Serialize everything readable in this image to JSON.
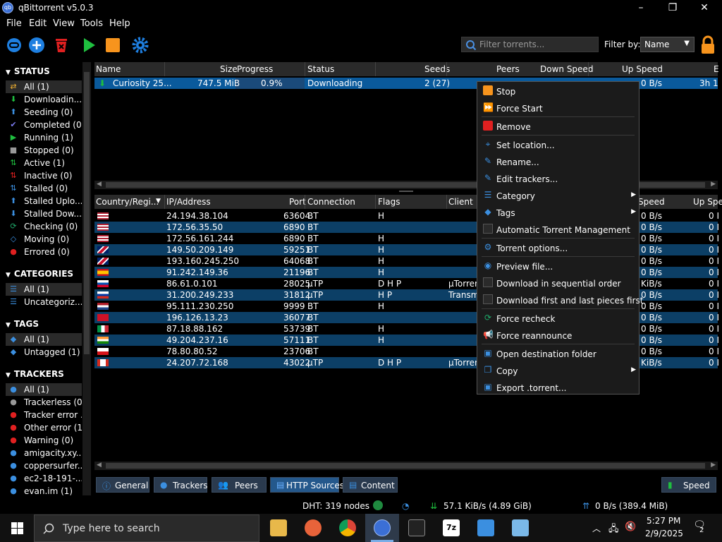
{
  "window": {
    "title": "qBittorrent v5.0.3",
    "app_icon": "qb",
    "minimize": "–",
    "maximize": "❐",
    "close": "✕"
  },
  "menubar": {
    "file": "File",
    "edit": "Edit",
    "view": "View",
    "tools": "Tools",
    "help": "Help"
  },
  "toolbar": {
    "filter_placeholder": "Filter torrents...",
    "filter_by_label": "Filter by:",
    "filter_by_value": "Name"
  },
  "sidebar": {
    "status_header": "STATUS",
    "status": [
      "All (1)",
      "Downloadin...",
      "Seeding (0)",
      "Completed (0)",
      "Running (1)",
      "Stopped (0)",
      "Active (1)",
      "Inactive (0)",
      "Stalled (0)",
      "Stalled Uplo...",
      "Stalled Dow...",
      "Checking (0)",
      "Moving (0)",
      "Errored (0)"
    ],
    "categories_header": "CATEGORIES",
    "categories": [
      "All (1)",
      "Uncategoriz..."
    ],
    "tags_header": "TAGS",
    "tags": [
      "All (1)",
      "Untagged (1)"
    ],
    "trackers_header": "TRACKERS",
    "trackers": [
      "All (1)",
      "Trackerless (0)",
      "Tracker error ...",
      "Other error (1)",
      "Warning (0)",
      "amigacity.xy...",
      "coppersurfer...",
      "ec2-18-191-...",
      "evan.im (1)"
    ]
  },
  "torrents": {
    "headers": [
      "Name",
      "Size",
      "Progress",
      "Status",
      "Seeds",
      "Peers",
      "Down Speed",
      "Up Speed",
      "E"
    ],
    "rows": [
      {
        "name": "Curiosity 25...",
        "size": "747.5 MiB",
        "progress": "0.9%",
        "status": "Downloading",
        "seeds": "2 (27)",
        "up": "0 B/s",
        "eta": "3h 1"
      }
    ]
  },
  "peers": {
    "headers": [
      "Country/Regi...",
      "IP/Address",
      "Port",
      "Connection",
      "Flags",
      "Client",
      "Speed",
      "Up Spe"
    ],
    "rows": [
      {
        "ip": "24.194.38.104",
        "port": "63604",
        "conn": "BT",
        "flags": "H",
        "client": "",
        "dl": "0 B/s",
        "ul": "0 I"
      },
      {
        "ip": "172.56.35.50",
        "port": "6890",
        "conn": "BT",
        "flags": "",
        "client": "",
        "dl": "0 B/s",
        "ul": "0 I"
      },
      {
        "ip": "172.56.161.244",
        "port": "6890",
        "conn": "BT",
        "flags": "H",
        "client": "",
        "dl": "0 B/s",
        "ul": "0 I"
      },
      {
        "ip": "149.50.209.149",
        "port": "59251",
        "conn": "BT",
        "flags": "H",
        "client": "",
        "dl": "0 B/s",
        "ul": "0 I"
      },
      {
        "ip": "193.160.245.250",
        "port": "64068",
        "conn": "BT",
        "flags": "H",
        "client": "",
        "dl": "0 B/s",
        "ul": "0 I"
      },
      {
        "ip": "91.242.149.36",
        "port": "21196",
        "conn": "BT",
        "flags": "H",
        "client": "",
        "dl": "0 B/s",
        "ul": "0 I"
      },
      {
        "ip": "86.61.0.101",
        "port": "28025",
        "conn": "µTP",
        "flags": "D H P",
        "client": "µTorrent",
        "dl": "KiB/s",
        "ul": "0 I"
      },
      {
        "ip": "31.200.249.233",
        "port": "31812",
        "conn": "µTP",
        "flags": "H P",
        "client": "Transm",
        "dl": "0 B/s",
        "ul": "0 I"
      },
      {
        "ip": "95.111.230.250",
        "port": "9999",
        "conn": "BT",
        "flags": "H",
        "client": "",
        "dl": "0 B/s",
        "ul": "0 I"
      },
      {
        "ip": "196.126.13.23",
        "port": "36077",
        "conn": "BT",
        "flags": "",
        "client": "",
        "dl": "0 B/s",
        "ul": "0 I"
      },
      {
        "ip": "87.18.88.162",
        "port": "53739",
        "conn": "BT",
        "flags": "H",
        "client": "",
        "dl": "0 B/s",
        "ul": "0 I"
      },
      {
        "ip": "49.204.237.16",
        "port": "57111",
        "conn": "BT",
        "flags": "H",
        "client": "",
        "dl": "0 B/s",
        "ul": "0 I"
      },
      {
        "ip": "78.80.80.52",
        "port": "23706",
        "conn": "BT",
        "flags": "",
        "client": "",
        "dl": "0 B/s",
        "ul": "0 I"
      },
      {
        "ip": "24.207.72.168",
        "port": "43022",
        "conn": "µTP",
        "flags": "D H P",
        "client": "µTorren",
        "dl": "KiB/s",
        "ul": "0 I"
      }
    ]
  },
  "tabs": {
    "general": "General",
    "trackers": "Trackers",
    "peers": "Peers",
    "http": "HTTP Sources",
    "content": "Content",
    "speed": "Speed"
  },
  "status": {
    "dht": "DHT: 319 nodes",
    "down": "57.1 KiB/s (4.89 GiB)",
    "up": "0 B/s (389.4 MiB)"
  },
  "context_menu": {
    "items": [
      "Stop",
      "Force Start",
      "Remove",
      "Set location...",
      "Rename...",
      "Edit trackers...",
      "Category",
      "Tags",
      "Automatic Torrent Management",
      "Torrent options...",
      "Preview file...",
      "Download in sequential order",
      "Download first and last pieces first",
      "Force recheck",
      "Force reannounce",
      "Open destination folder",
      "Copy",
      "Export .torrent..."
    ]
  },
  "taskbar": {
    "search_placeholder": "Type here to search",
    "time": "5:27 PM",
    "date": "2/9/2025",
    "notifications": "2"
  }
}
